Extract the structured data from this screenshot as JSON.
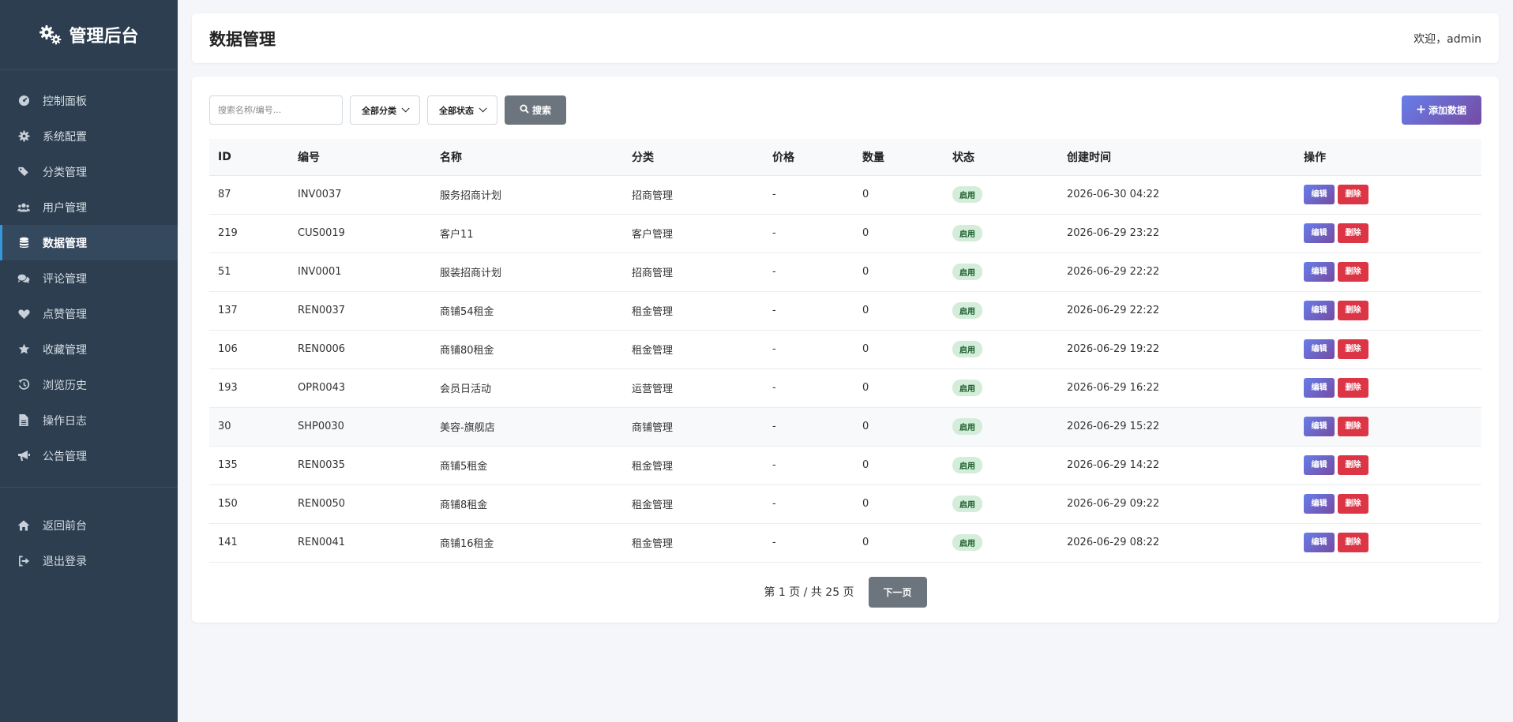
{
  "sidebar": {
    "brand": "管理后台",
    "items": [
      {
        "label": "控制面板",
        "icon": "dashboard-icon"
      },
      {
        "label": "系统配置",
        "icon": "gear-icon"
      },
      {
        "label": "分类管理",
        "icon": "tags-icon"
      },
      {
        "label": "用户管理",
        "icon": "users-icon"
      },
      {
        "label": "数据管理",
        "icon": "database-icon",
        "active": true
      },
      {
        "label": "评论管理",
        "icon": "comments-icon"
      },
      {
        "label": "点赞管理",
        "icon": "heart-icon"
      },
      {
        "label": "收藏管理",
        "icon": "star-icon"
      },
      {
        "label": "浏览历史",
        "icon": "history-icon"
      },
      {
        "label": "操作日志",
        "icon": "file-icon"
      },
      {
        "label": "公告管理",
        "icon": "bullhorn-icon"
      }
    ],
    "bottom_items": [
      {
        "label": "返回前台",
        "icon": "home-icon"
      },
      {
        "label": "退出登录",
        "icon": "sign-out-icon"
      }
    ]
  },
  "header": {
    "title": "数据管理",
    "welcome": "欢迎，admin"
  },
  "toolbar": {
    "search_placeholder": "搜索名称/编号...",
    "category_select": "全部分类",
    "status_select": "全部状态",
    "search_label": "搜索",
    "add_label": "添加数据"
  },
  "table": {
    "columns": [
      "ID",
      "编号",
      "名称",
      "分类",
      "价格",
      "数量",
      "状态",
      "创建时间",
      "操作"
    ],
    "rows": [
      {
        "id": "87",
        "code": "INV0037",
        "name": "服务招商计划",
        "category": "招商管理",
        "price": "-",
        "qty": "0",
        "status": "启用",
        "created": "2026-06-30 04:22"
      },
      {
        "id": "219",
        "code": "CUS0019",
        "name": "客户11",
        "category": "客户管理",
        "price": "-",
        "qty": "0",
        "status": "启用",
        "created": "2026-06-29 23:22"
      },
      {
        "id": "51",
        "code": "INV0001",
        "name": "服装招商计划",
        "category": "招商管理",
        "price": "-",
        "qty": "0",
        "status": "启用",
        "created": "2026-06-29 22:22"
      },
      {
        "id": "137",
        "code": "REN0037",
        "name": "商铺54租金",
        "category": "租金管理",
        "price": "-",
        "qty": "0",
        "status": "启用",
        "created": "2026-06-29 22:22"
      },
      {
        "id": "106",
        "code": "REN0006",
        "name": "商铺80租金",
        "category": "租金管理",
        "price": "-",
        "qty": "0",
        "status": "启用",
        "created": "2026-06-29 19:22"
      },
      {
        "id": "193",
        "code": "OPR0043",
        "name": "会员日活动",
        "category": "运营管理",
        "price": "-",
        "qty": "0",
        "status": "启用",
        "created": "2026-06-29 16:22"
      },
      {
        "id": "30",
        "code": "SHP0030",
        "name": "美容-旗舰店",
        "category": "商铺管理",
        "price": "-",
        "qty": "0",
        "status": "启用",
        "created": "2026-06-29 15:22"
      },
      {
        "id": "135",
        "code": "REN0035",
        "name": "商铺5租金",
        "category": "租金管理",
        "price": "-",
        "qty": "0",
        "status": "启用",
        "created": "2026-06-29 14:22"
      },
      {
        "id": "150",
        "code": "REN0050",
        "name": "商铺8租金",
        "category": "租金管理",
        "price": "-",
        "qty": "0",
        "status": "启用",
        "created": "2026-06-29 09:22"
      },
      {
        "id": "141",
        "code": "REN0041",
        "name": "商铺16租金",
        "category": "租金管理",
        "price": "-",
        "qty": "0",
        "status": "启用",
        "created": "2026-06-29 08:22"
      }
    ],
    "edit_label": "编辑",
    "delete_label": "删除"
  },
  "pagination": {
    "info": "第 1 页 / 共 25 页",
    "next_label": "下一页"
  },
  "colors": {
    "sidebar_bg": "#2c3e50",
    "accent_start": "#667eea",
    "accent_end": "#764ba2",
    "danger": "#dc3545",
    "badge_bg": "#d4edda"
  }
}
